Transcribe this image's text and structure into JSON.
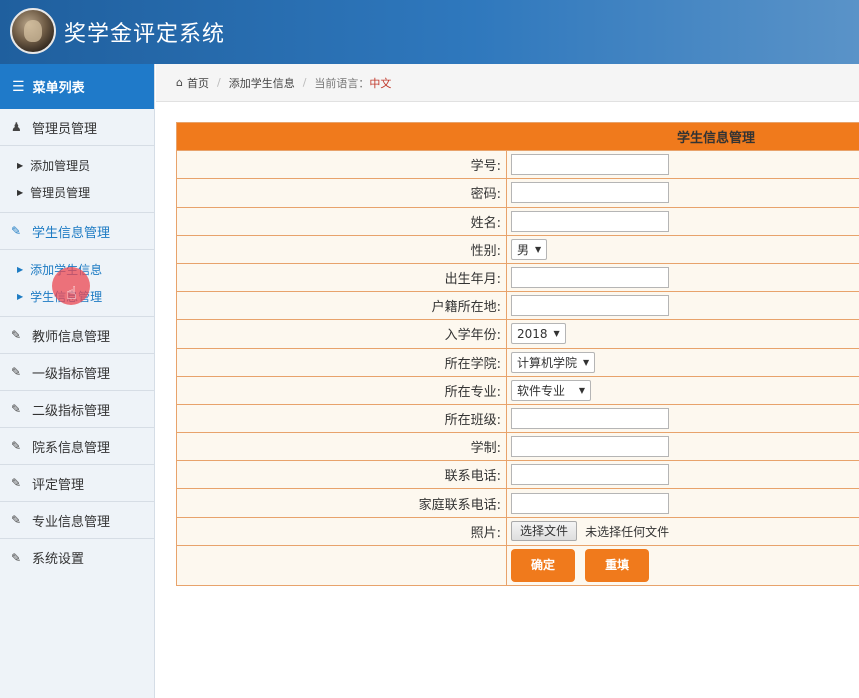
{
  "header": {
    "title": "奖学金评定系统"
  },
  "sidebar": {
    "menu_title": "菜单列表",
    "groups": [
      {
        "label": "管理员管理",
        "items": [
          "添加管理员",
          "管理员管理"
        ]
      },
      {
        "label": "学生信息管理",
        "items": [
          "添加学生信息",
          "学生信息管理"
        ]
      },
      {
        "label": "教师信息管理"
      },
      {
        "label": "一级指标管理"
      },
      {
        "label": "二级指标管理"
      },
      {
        "label": "院系信息管理"
      },
      {
        "label": "评定管理"
      },
      {
        "label": "专业信息管理"
      },
      {
        "label": "系统设置"
      }
    ]
  },
  "breadcrumb": {
    "home": "首页",
    "current": "添加学生信息",
    "lang_label": "当前语言：",
    "lang_value": "中文"
  },
  "form": {
    "title": "学生信息管理",
    "fields": {
      "student_no": {
        "label": "学号:",
        "value": ""
      },
      "password": {
        "label": "密码:",
        "value": ""
      },
      "name": {
        "label": "姓名:",
        "value": ""
      },
      "gender": {
        "label": "性别:",
        "value": "男"
      },
      "birth": {
        "label": "出生年月:",
        "value": ""
      },
      "hometown": {
        "label": "户籍所在地:",
        "value": ""
      },
      "enroll_year": {
        "label": "入学年份:",
        "value": "2018"
      },
      "college": {
        "label": "所在学院:",
        "value": "计算机学院"
      },
      "major": {
        "label": "所在专业:",
        "value": "软件专业"
      },
      "class": {
        "label": "所在班级:",
        "value": ""
      },
      "schooling": {
        "label": "学制:",
        "value": ""
      },
      "phone": {
        "label": "联系电话:",
        "value": ""
      },
      "family_phone": {
        "label": "家庭联系电话:",
        "value": ""
      },
      "photo": {
        "label": "照片:",
        "button": "选择文件",
        "status": "未选择任何文件"
      }
    },
    "submit": "确定",
    "reset": "重填"
  }
}
